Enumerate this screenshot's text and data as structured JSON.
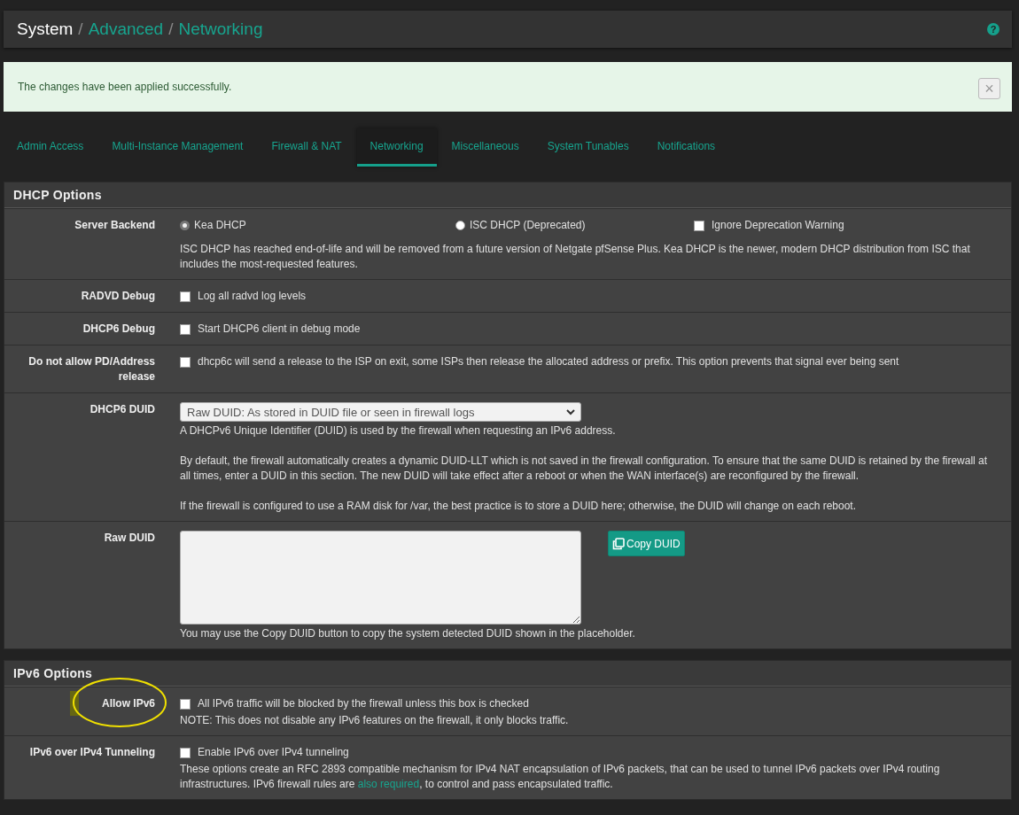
{
  "breadcrumb": {
    "separator": "/",
    "items": [
      {
        "label": "System",
        "link": false
      },
      {
        "label": "Advanced",
        "link": true
      },
      {
        "label": "Networking",
        "link": true
      }
    ],
    "help_icon": "?"
  },
  "alert": {
    "message": "The changes have been applied successfully.",
    "close": "×"
  },
  "tabs": [
    {
      "label": "Admin Access",
      "selected": false
    },
    {
      "label": "Multi-Instance Management",
      "selected": false
    },
    {
      "label": "Firewall & NAT",
      "selected": false
    },
    {
      "label": "Networking",
      "selected": true
    },
    {
      "label": "Miscellaneous",
      "selected": false
    },
    {
      "label": "System Tunables",
      "selected": false
    },
    {
      "label": "Notifications",
      "selected": false
    }
  ],
  "sections": [
    {
      "title": "DHCP Options",
      "rows": [
        {
          "kind": "backend",
          "label": "Server Backend",
          "options": [
            {
              "label": "Kea DHCP",
              "selected": true
            },
            {
              "label": "ISC DHCP (Deprecated)",
              "selected": false
            }
          ],
          "checkbox": {
            "label": "Ignore Deprecation Warning",
            "checked": false
          },
          "help": [
            "ISC DHCP has reached end-of-life and will be removed from a future version of Netgate pfSense Plus. Kea DHCP is the newer, modern DHCP distribution from ISC that includes the most-requested features."
          ]
        },
        {
          "kind": "checkbox",
          "label": "RADVD Debug",
          "checkbox": {
            "label": "Log all radvd log levels",
            "checked": false
          }
        },
        {
          "kind": "checkbox",
          "label": "DHCP6 Debug",
          "checkbox": {
            "label": "Start DHCP6 client in debug mode",
            "checked": false
          }
        },
        {
          "kind": "checkbox",
          "label": "Do not allow PD/Address release",
          "checkbox": {
            "label": "dhcp6c will send a release to the ISP on exit, some ISPs then release the allocated address or prefix. This option prevents that signal ever being sent",
            "checked": false
          }
        },
        {
          "kind": "select",
          "label": "DHCP6 DUID",
          "value": "Raw DUID: As stored in DUID file or seen in firewall logs",
          "help": [
            "A DHCPv6 Unique Identifier (DUID) is used by the firewall when requesting an IPv6 address.",
            "By default, the firewall automatically creates a dynamic DUID-LLT which is not saved in the firewall configuration. To ensure that the same DUID is retained by the firewall at all times, enter a DUID in this section. The new DUID will take effect after a reboot or when the WAN interface(s) are reconfigured by the firewall.",
            "If the firewall is configured to use a RAM disk for /var, the best practice is to store a DUID here; otherwise, the DUID will change on each reboot."
          ]
        },
        {
          "kind": "textarea",
          "label": "Raw DUID",
          "button": "Copy DUID",
          "help": [
            "You may use the Copy DUID button to copy the system detected DUID shown in the placeholder."
          ]
        }
      ]
    },
    {
      "title": "IPv6 Options",
      "rows": [
        {
          "kind": "checkbox",
          "label": "Allow IPv6",
          "highlighted": true,
          "checkbox": {
            "label": "All IPv6 traffic will be blocked by the firewall unless this box is checked",
            "checked": false
          },
          "help": [
            "NOTE: This does not disable any IPv6 features on the firewall, it only blocks traffic."
          ]
        },
        {
          "kind": "checkbox",
          "label": "IPv6 over IPv4 Tunneling",
          "checkbox": {
            "label": "Enable IPv6 over IPv4 tunneling",
            "checked": false
          },
          "help": [
            [
              {
                "text": "These options create an RFC 2893 compatible mechanism for IPv4 NAT encapsulation of IPv6 packets, that can be used to tunnel IPv6 packets over IPv4 routing infrastructures. IPv6 firewall rules are "
              },
              {
                "text": "also required",
                "link": true
              },
              {
                "text": ", to control and pass encapsulated traffic."
              }
            ]
          ]
        }
      ]
    }
  ]
}
